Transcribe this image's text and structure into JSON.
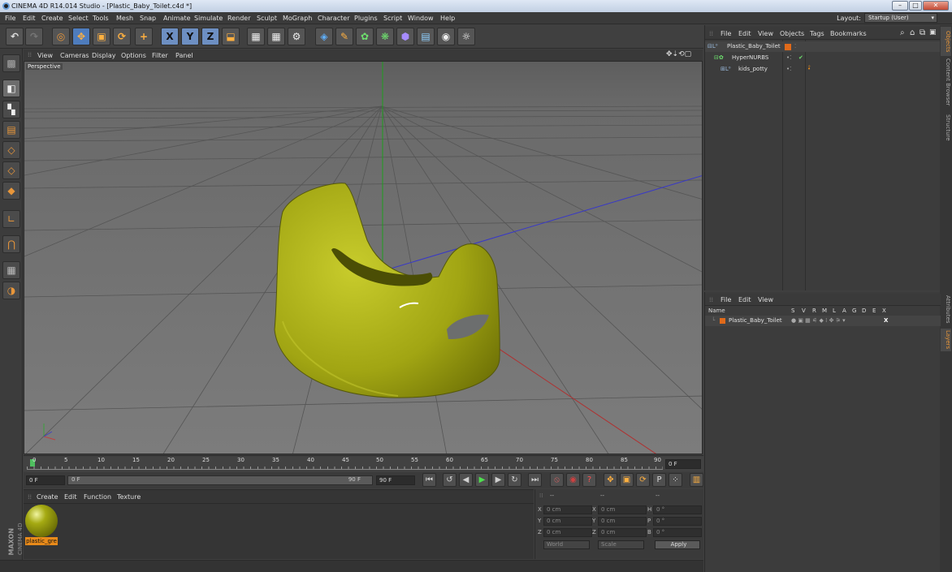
{
  "window": {
    "title": "CINEMA 4D R14.014 Studio - [Plastic_Baby_Toilet.c4d *]"
  },
  "menubar": {
    "items": [
      "File",
      "Edit",
      "Create",
      "Select",
      "Tools",
      "Mesh",
      "Snap",
      "Animate",
      "Simulate",
      "Render",
      "Sculpt",
      "MoGraph",
      "Character",
      "Plugins",
      "Script",
      "Window",
      "Help"
    ],
    "layout_label": "Layout:",
    "layout_value": "Startup (User)"
  },
  "toolbar": {
    "axis_x": "X",
    "axis_y": "Y",
    "axis_z": "Z"
  },
  "viewport": {
    "menu": [
      "View",
      "Cameras",
      "Display",
      "Options",
      "Filter",
      "Panel"
    ],
    "camera_label": "Perspective",
    "object_color": "#a8ac14"
  },
  "timeline": {
    "ticks": [
      "0",
      "5",
      "10",
      "15",
      "20",
      "25",
      "30",
      "35",
      "40",
      "45",
      "50",
      "55",
      "60",
      "65",
      "70",
      "75",
      "80",
      "85",
      "90"
    ],
    "current_frame": "0 F",
    "start_field": "0 F",
    "range_start": "0 F",
    "range_end": "90 F",
    "end_field": "90 F"
  },
  "material_manager": {
    "menu": [
      "Create",
      "Edit",
      "Function",
      "Texture"
    ],
    "material_name": "plastic_gre"
  },
  "coordinates": {
    "header_dashes": [
      "--",
      "--",
      "--"
    ],
    "rows": [
      {
        "a_label": "X",
        "a_val": "0 cm",
        "b_label": "X",
        "b_val": "0 cm",
        "c_label": "H",
        "c_val": "0 °"
      },
      {
        "a_label": "Y",
        "a_val": "0 cm",
        "b_label": "Y",
        "b_val": "0 cm",
        "c_label": "P",
        "c_val": "0 °"
      },
      {
        "a_label": "Z",
        "a_val": "0 cm",
        "b_label": "Z",
        "b_val": "0 cm",
        "c_label": "B",
        "c_val": "0 °"
      }
    ],
    "world_select": "World",
    "scale_select": "Scale",
    "apply_label": "Apply"
  },
  "object_manager": {
    "menu": [
      "File",
      "Edit",
      "View",
      "Objects",
      "Tags",
      "Bookmarks"
    ],
    "objects": [
      "Plastic_Baby_Toilet",
      "HyperNURBS",
      "kids_potty"
    ]
  },
  "side_tabs": [
    "Objects",
    "Content Browser",
    "Structure",
    "Attributes",
    "Layers"
  ],
  "attributes": {
    "menu": [
      "File",
      "Edit",
      "View"
    ],
    "columns": [
      "Name",
      "S",
      "V",
      "R",
      "M",
      "L",
      "A",
      "G",
      "D",
      "E",
      "X"
    ],
    "layer_name": "Plastic_Baby_Toilet"
  },
  "branding": {
    "maxon": "MAXON",
    "product": "CINEMA 4D"
  }
}
